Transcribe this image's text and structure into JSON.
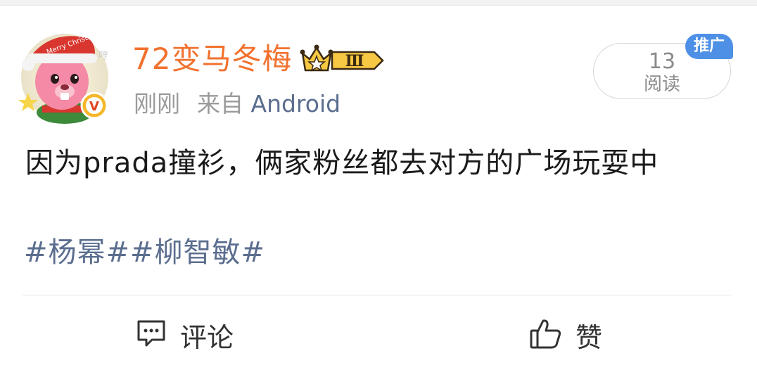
{
  "post": {
    "author": {
      "name": "72变马冬梅",
      "level_badge": "Ⅲ",
      "verified_badge": "V",
      "avatar_caption": "Merry Christmas",
      "avatar_hint": "哼"
    },
    "time": "刚刚",
    "source_prefix": "来自",
    "source": "Android",
    "reads": {
      "count": "13",
      "label": "阅读"
    },
    "promo_tag": "推广",
    "content": "因为prada撞衫，俩家粉丝都去对方的广场玩耍中",
    "hashtags": "#杨幂##柳智敏#"
  },
  "actions": {
    "comment_label": "评论",
    "like_label": "赞"
  },
  "colors": {
    "username": "#f2712e",
    "link": "#5b6e8f",
    "promo": "#4e90e6",
    "badge_gold": "#f5b72a"
  }
}
